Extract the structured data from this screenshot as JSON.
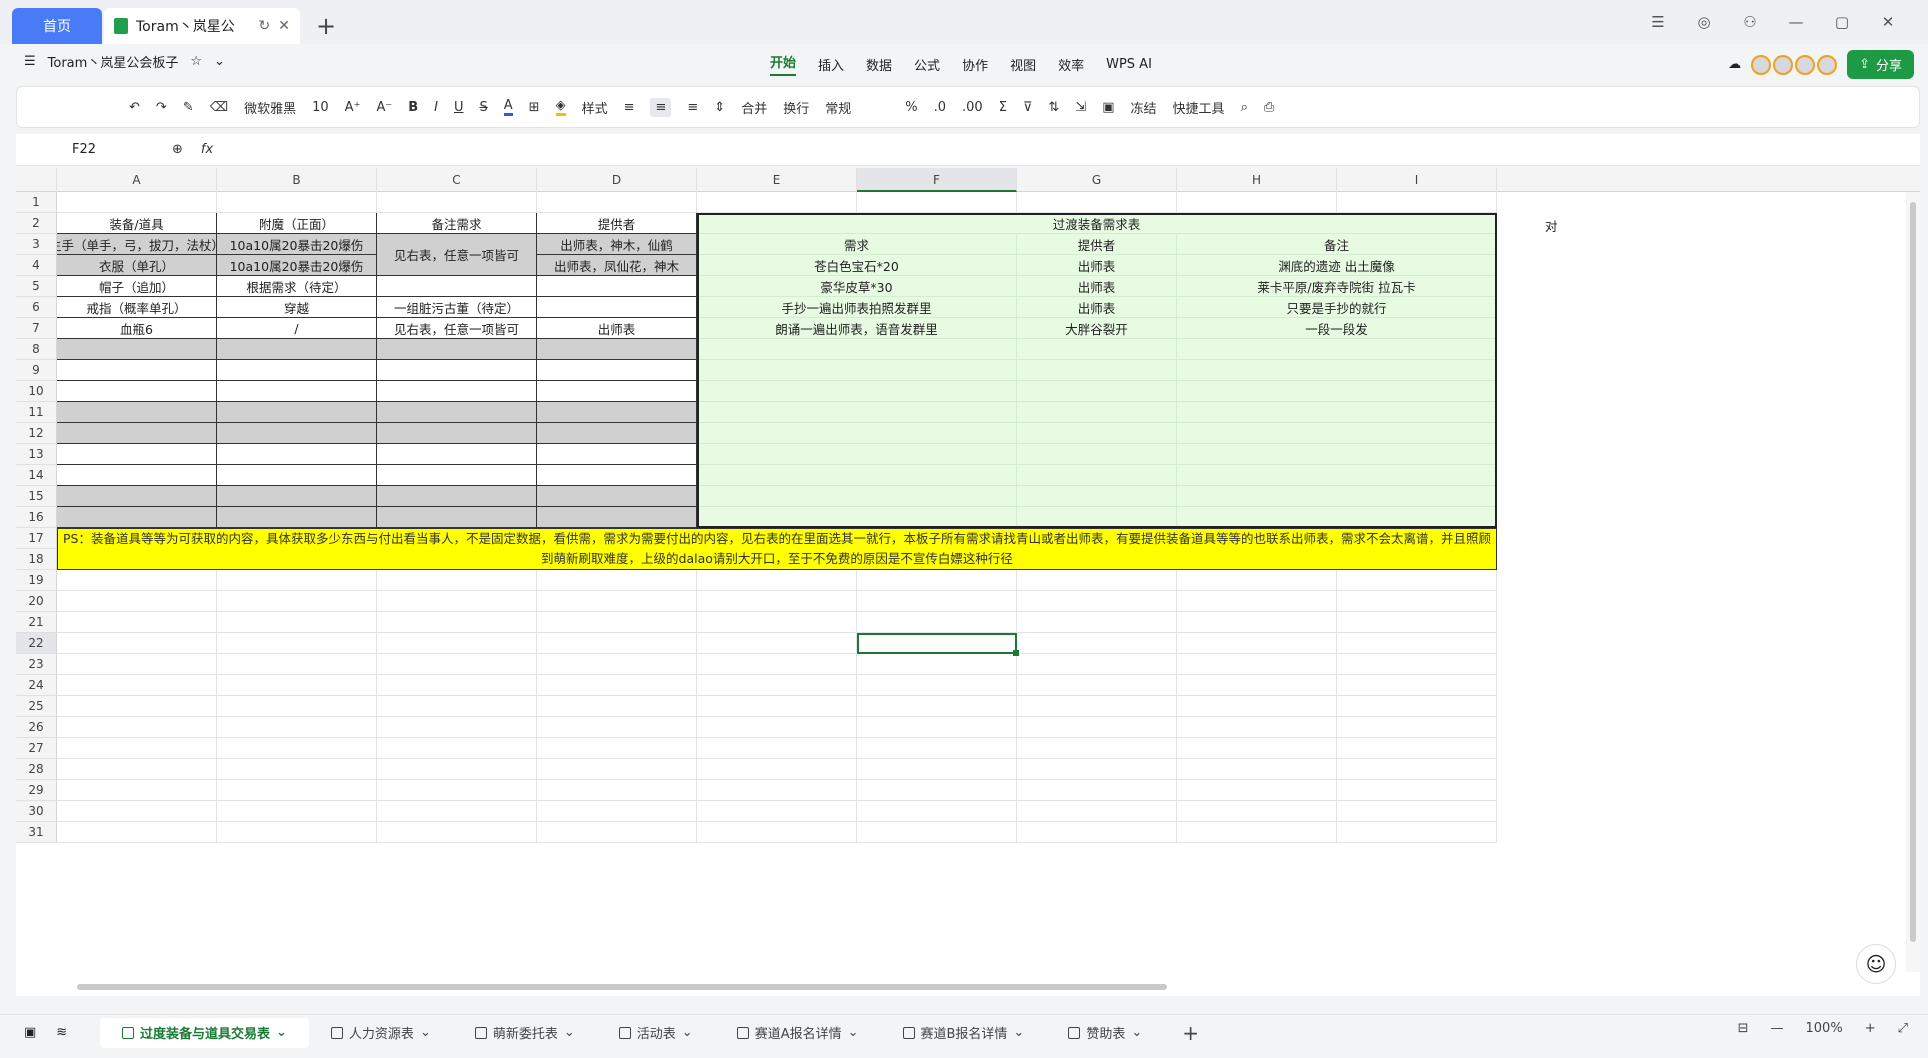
{
  "titlebar": {
    "home_label": "首页",
    "doc_tab_title": "Toram丶岚星公",
    "reload_icon": "↻",
    "close_icon": "✕",
    "new_tab_icon": "+",
    "window_controls": [
      "☰",
      "◎",
      "⚇",
      "—",
      "▢",
      "✕"
    ]
  },
  "menubar": {
    "hamburger": "☰",
    "doc_name": "Toram丶岚星公会板子",
    "star_icon": "☆",
    "dropdown_icon": "⌄",
    "tabs": [
      "开始",
      "插入",
      "数据",
      "公式",
      "协作",
      "视图",
      "效率",
      "WPS AI"
    ],
    "active_tab": "开始",
    "share_label": "分享",
    "cloud_icon": "☁"
  },
  "toolbar": {
    "undo": "↶",
    "redo": "↷",
    "format_painter": "✎",
    "eraser": "⌫",
    "font_name": "微软雅黑",
    "font_size": "10",
    "grow": "A⁺",
    "shrink": "A⁻",
    "bold": "B",
    "italic": "I",
    "underline": "U",
    "strike": "S",
    "font_color": "A",
    "border": "⊞",
    "fill": "◈",
    "style_label": "样式",
    "align_left": "≡",
    "align_center": "≡",
    "align_right": "≡",
    "valign": "⇕",
    "merge_label": "合并",
    "wrap_label": "换行",
    "number_format": "常规",
    "percent": "%",
    "dec_inc": ".0",
    "dec_dec": ".00",
    "sum": "Σ",
    "filter": "⊽",
    "sort": "⇅",
    "fill_series": "⇲",
    "image": "▣",
    "freeze_label": "冻结",
    "quick_tools_label": "快捷工具",
    "search": "⌕",
    "print": "⎙"
  },
  "formulabar": {
    "namebox": "F22",
    "zoom_icon": "⊕",
    "fx": "fx",
    "formula": ""
  },
  "columns": [
    "A",
    "B",
    "C",
    "D",
    "E",
    "F",
    "G",
    "H",
    "I"
  ],
  "selected_column": "F",
  "selected_row": "22",
  "rows": [
    "1",
    "2",
    "3",
    "4",
    "5",
    "6",
    "7",
    "8",
    "9",
    "10",
    "11",
    "12",
    "13",
    "14",
    "15",
    "16",
    "17",
    "18",
    "19",
    "20",
    "21",
    "22",
    "23",
    "24",
    "25",
    "26",
    "27",
    "28",
    "29",
    "30",
    "31"
  ],
  "table_left": {
    "headers": [
      "装备/道具",
      "附魔（正面）",
      "备注需求",
      "提供者"
    ],
    "rows": [
      [
        "主手（单手，弓，拔刀，法杖）",
        "10a10属20暴击20爆伤",
        "见右表，任意一项皆可",
        "出师表，神木，仙鹤"
      ],
      [
        "衣服（单孔）",
        "10a10属20暴击20爆伤",
        "",
        "出师表，凤仙花，神木"
      ],
      [
        "帽子（追加）",
        "根据需求（待定）",
        "",
        ""
      ],
      [
        "戒指（概率单孔）",
        "穿越",
        "一组脏污古董（待定）",
        ""
      ],
      [
        "血瓶6",
        "/",
        "见右表，任意一项皆可",
        "出师表"
      ]
    ]
  },
  "table_right": {
    "title": "过渡装备需求表",
    "headers": [
      "需求",
      "提供者",
      "备注"
    ],
    "rows": [
      [
        "苍白色宝石*20",
        "出师表",
        "渊底的遗迹 出土魔像"
      ],
      [
        "豪华皮草*30",
        "出师表",
        "莱卡平原/废弃寺院街 拉瓦卡"
      ],
      [
        "手抄一遍出师表拍照发群里",
        "出师表",
        "只要是手抄的就行"
      ],
      [
        "朗诵一遍出师表，语音发群里",
        "大胖谷裂开",
        "一段一段发"
      ]
    ],
    "overflow_text": "对"
  },
  "ps_note": "PS：装备道具等等为可获取的内容，具体获取多少东西与付出看当事人，不是固定数据，看供需，需求为需要付出的内容，见右表的在里面选其一就行，本板子所有需求请找青山或者出师表，有要提供装备道具等等的也联系出师表，需求不会太离谱，并且照顾到萌新刷取难度，上级的dalao请别大开口，至于不免费的原因是不宣传白嫖这种行径",
  "sheets": [
    "过度装备与道具交易表",
    "人力资源表",
    "萌新委托表",
    "活动表",
    "赛道A报名详情",
    "赛道B报名详情",
    "赞助表"
  ],
  "active_sheet": "过度装备与道具交易表",
  "status": {
    "zoom": "100%",
    "minus": "—",
    "plus": "+",
    "fullscreen": "⤢"
  },
  "colors": {
    "accent": "#1a7a35",
    "home_tab": "#4a7bf7",
    "gray_fill": "#d0d0d0",
    "green_fill": "#e6fbe1",
    "yellow_fill": "#ffff00"
  }
}
